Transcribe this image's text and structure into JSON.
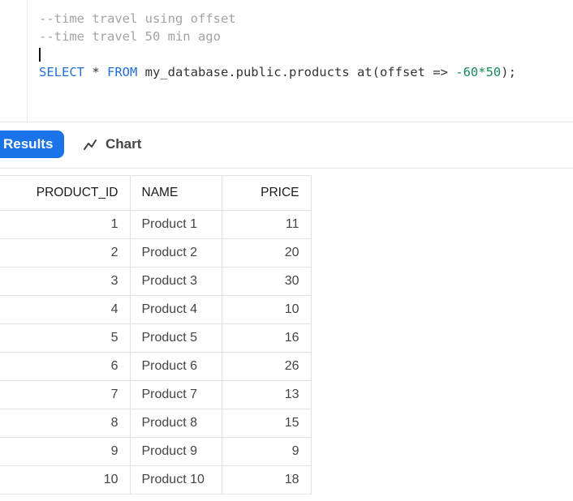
{
  "editor": {
    "comment_1": "--time travel using offset",
    "comment_2": "--time travel 50 min ago",
    "query": {
      "kw_select": "SELECT",
      "star": " * ",
      "kw_from": "FROM",
      "table": " my_database.public.products at(offset => ",
      "number": "-60*50",
      "tail": ");"
    }
  },
  "tabs": {
    "results_label": "Results",
    "chart_label": "Chart",
    "chart_icon": "line-chart-icon",
    "accent_color": "#1a73e8"
  },
  "table": {
    "columns": [
      "PRODUCT_ID",
      "NAME",
      "PRICE"
    ],
    "rows": [
      [
        "1",
        "Product 1",
        "11"
      ],
      [
        "2",
        "Product 2",
        "20"
      ],
      [
        "3",
        "Product 3",
        "30"
      ],
      [
        "4",
        "Product 4",
        "10"
      ],
      [
        "5",
        "Product 5",
        "16"
      ],
      [
        "6",
        "Product 6",
        "26"
      ],
      [
        "7",
        "Product 7",
        "13"
      ],
      [
        "8",
        "Product 8",
        "15"
      ],
      [
        "9",
        "Product 9",
        "9"
      ],
      [
        "10",
        "Product 10",
        "18"
      ]
    ]
  }
}
